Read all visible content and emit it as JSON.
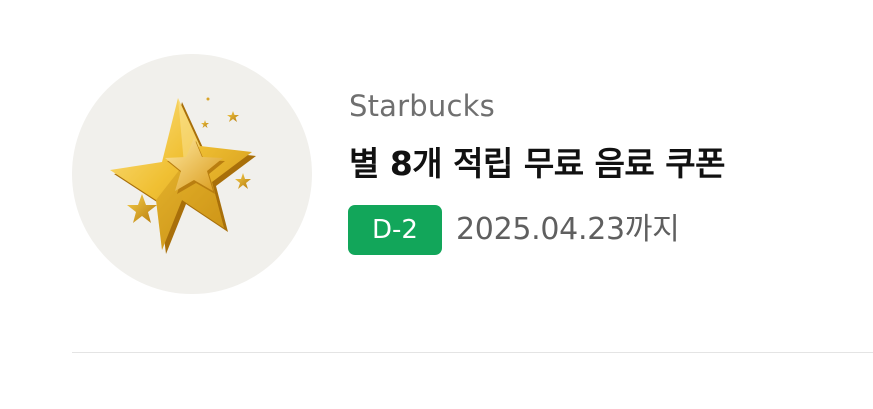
{
  "coupon": {
    "image_icon": "gold-star-icon",
    "brand": "Starbucks",
    "title": "별 8개 적립 무료 음료 쿠폰",
    "dday_badge": "D-2",
    "expiry": "2025.04.23까지"
  },
  "colors": {
    "badge_bg": "#12a65a",
    "thumb_bg": "#f1f0ec",
    "star_gold": "#e8b020"
  }
}
